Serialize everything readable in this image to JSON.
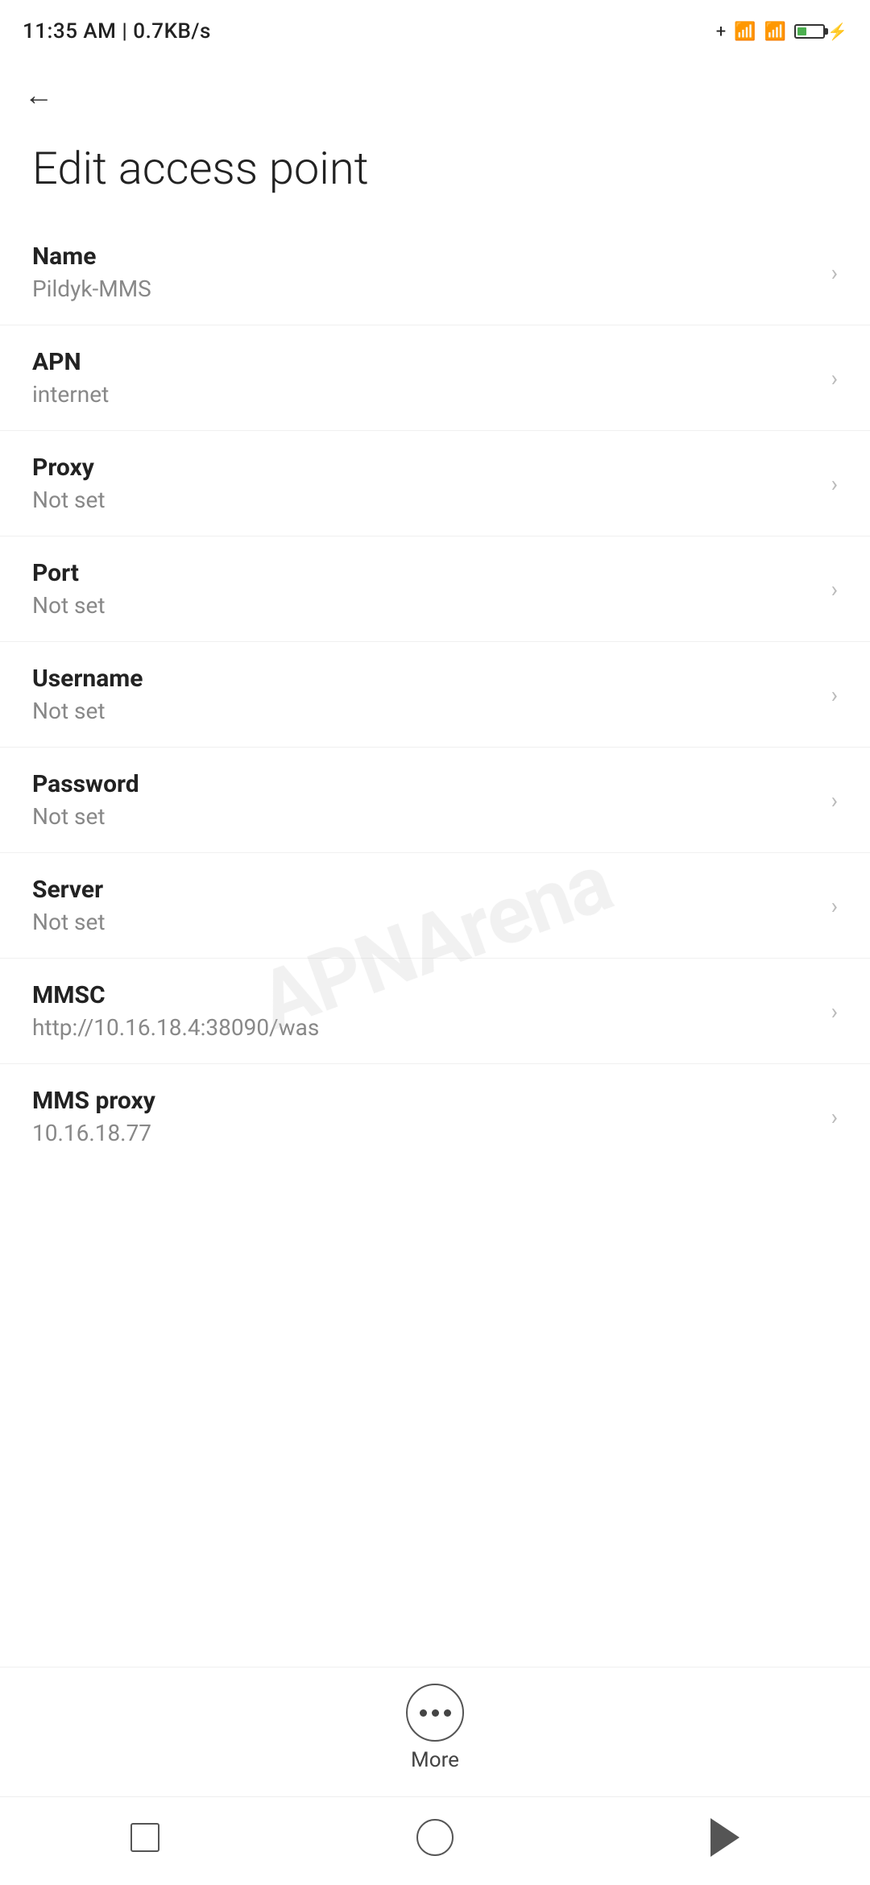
{
  "statusBar": {
    "time": "11:35 AM | 0.7KB/s",
    "battery": "38"
  },
  "toolbar": {
    "back_label": "←"
  },
  "page": {
    "title": "Edit access point"
  },
  "settings": {
    "items": [
      {
        "label": "Name",
        "value": "Pildyk-MMS"
      },
      {
        "label": "APN",
        "value": "internet"
      },
      {
        "label": "Proxy",
        "value": "Not set"
      },
      {
        "label": "Port",
        "value": "Not set"
      },
      {
        "label": "Username",
        "value": "Not set"
      },
      {
        "label": "Password",
        "value": "Not set"
      },
      {
        "label": "Server",
        "value": "Not set"
      },
      {
        "label": "MMSC",
        "value": "http://10.16.18.4:38090/was"
      },
      {
        "label": "MMS proxy",
        "value": "10.16.18.77"
      }
    ]
  },
  "more": {
    "label": "More"
  },
  "navBar": {
    "square": "■",
    "circle": "●",
    "triangle": "◀"
  }
}
